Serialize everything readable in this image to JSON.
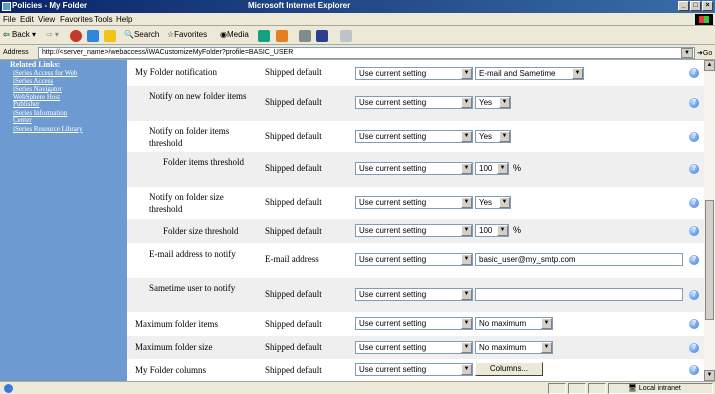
{
  "window": {
    "title": "Policies - My Folder",
    "app": "Microsoft Internet Explorer"
  },
  "menu": [
    "File",
    "Edit",
    "View",
    "Favorites",
    "Tools",
    "Help"
  ],
  "toolbar": {
    "back": "Back",
    "search": "Search",
    "favorites": "Favorites",
    "media": "Media"
  },
  "address": {
    "label": "Address",
    "url": "http://<server_name>/webaccess/iWACustomizeMyFolder?profile=BASIC_USER",
    "go": "Go"
  },
  "sidebar": {
    "heading": "Related Links:",
    "links": [
      "iSeries Access for Web",
      "iSeries Access",
      "iSeries Navigator",
      "WebSphere Host Publisher",
      "iSeries Information Center",
      "iSeries Resource Library"
    ]
  },
  "rows": [
    {
      "label": "My Folder notification",
      "default": "Shipped default",
      "setting": "Use current setting",
      "value": "E-mail and Sametime"
    },
    {
      "label": "Notify on new folder items",
      "default": "Shipped default",
      "setting": "Use current setting",
      "value": "Yes"
    },
    {
      "label": "Notify on folder items threshold",
      "default": "Shipped default",
      "setting": "Use current setting",
      "value": "Yes"
    },
    {
      "label": "Folder items threshold",
      "default": "Shipped default",
      "setting": "Use current setting",
      "value": "100",
      "unit": "%"
    },
    {
      "label": "Notify on folder size threshold",
      "default": "Shipped default",
      "setting": "Use current setting",
      "value": "Yes"
    },
    {
      "label": "Folder size threshold",
      "default": "Shipped default",
      "setting": "Use current setting",
      "value": "100",
      "unit": "%"
    },
    {
      "label": "E-mail address to notify",
      "default": "E-mail address",
      "setting": "Use current setting",
      "value": "basic_user@my_smtp.com"
    },
    {
      "label": "Sametime user to notify",
      "default": "Shipped default",
      "setting": "Use current setting",
      "value": ""
    },
    {
      "label": "Maximum folder items",
      "default": "Shipped default",
      "setting": "Use current setting",
      "value": "No maximum"
    },
    {
      "label": "Maximum folder size",
      "default": "Shipped default",
      "setting": "Use current setting",
      "value": "No maximum"
    },
    {
      "label": "My Folder columns",
      "default": "Shipped default",
      "setting": "Use current setting",
      "value": "Columns..."
    }
  ],
  "help": "?",
  "status": {
    "zone": "Local intranet"
  }
}
